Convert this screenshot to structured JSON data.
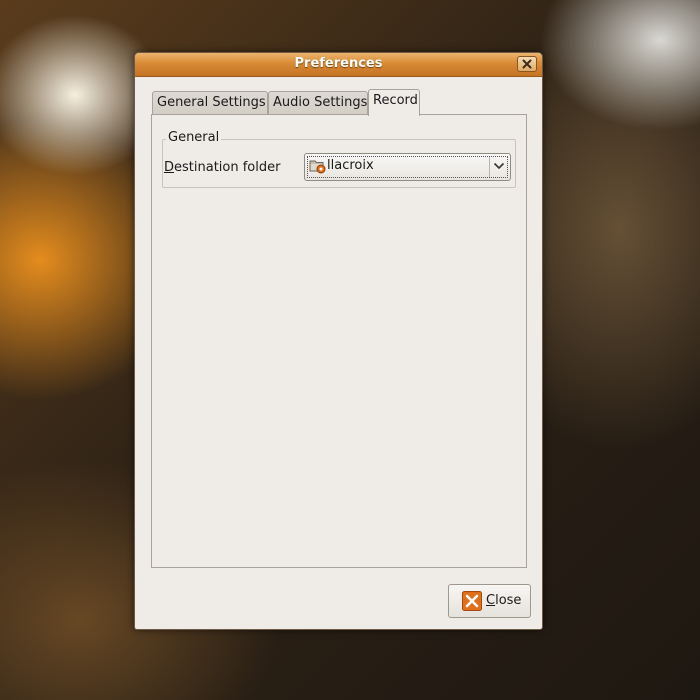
{
  "window": {
    "title": "Preferences"
  },
  "tabs": [
    {
      "label": "General Settings",
      "active": false
    },
    {
      "label": "Audio Settings",
      "active": false
    },
    {
      "label": "Record",
      "active": true
    }
  ],
  "record": {
    "group_title": "General",
    "destination": {
      "label_mnemonic": "D",
      "label_rest": "estination folder",
      "value": "llacroix",
      "icon": "folder-home-icon"
    }
  },
  "footer": {
    "close_mnemonic": "C",
    "close_rest": "lose",
    "close_icon": "close-x-icon"
  },
  "colors": {
    "titlebar": "#d88a35",
    "dialog_bg": "#efebe7",
    "close_icon_orange": "#e0701c"
  }
}
